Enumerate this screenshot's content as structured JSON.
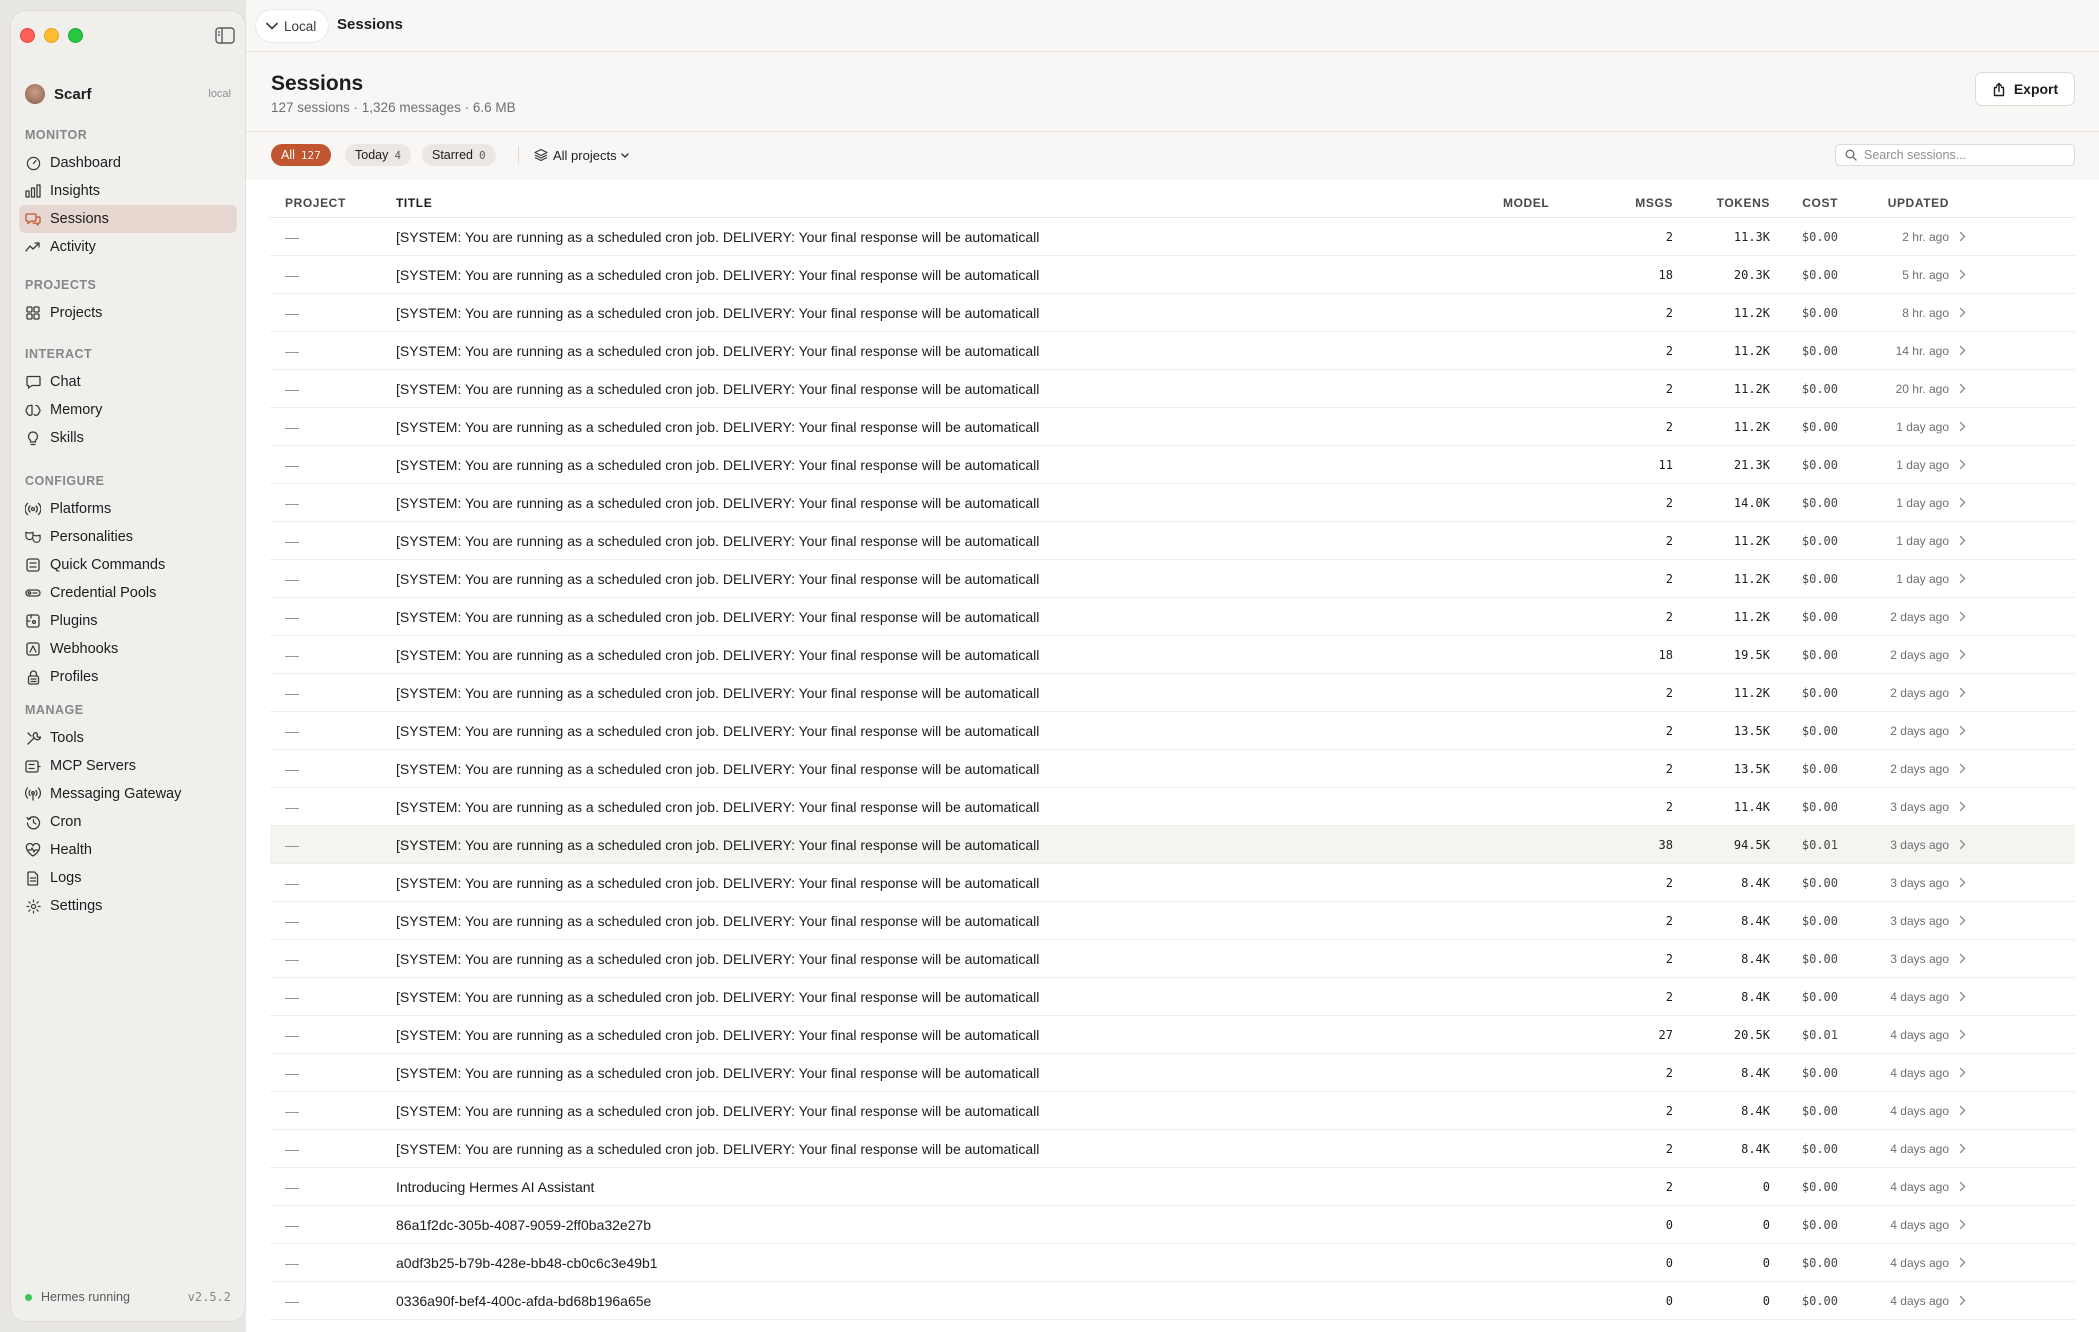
{
  "sidebar": {
    "profile": {
      "name": "Scarf",
      "badge": "local"
    },
    "sections": [
      {
        "heading": "MONITOR",
        "items": [
          {
            "label": "Dashboard",
            "icon": "gauge-icon"
          },
          {
            "label": "Insights",
            "icon": "bar-chart-icon"
          },
          {
            "label": "Sessions",
            "icon": "chat-bubbles-icon",
            "active": true
          },
          {
            "label": "Activity",
            "icon": "activity-icon"
          }
        ]
      },
      {
        "heading": "PROJECTS",
        "items": [
          {
            "label": "Projects",
            "icon": "grid-icon"
          }
        ]
      },
      {
        "heading": "INTERACT",
        "items": [
          {
            "label": "Chat",
            "icon": "chat-icon"
          },
          {
            "label": "Memory",
            "icon": "brain-icon"
          },
          {
            "label": "Skills",
            "icon": "lightbulb-icon"
          }
        ]
      },
      {
        "heading": "CONFIGURE",
        "items": [
          {
            "label": "Platforms",
            "icon": "broadcast-icon"
          },
          {
            "label": "Personalities",
            "icon": "masks-icon"
          },
          {
            "label": "Quick Commands",
            "icon": "command-icon"
          },
          {
            "label": "Credential Pools",
            "icon": "key-icon"
          },
          {
            "label": "Plugins",
            "icon": "puzzle-icon"
          },
          {
            "label": "Webhooks",
            "icon": "webhook-icon"
          },
          {
            "label": "Profiles",
            "icon": "lock-icon"
          }
        ]
      },
      {
        "heading": "MANAGE",
        "items": [
          {
            "label": "Tools",
            "icon": "wrench-icon"
          },
          {
            "label": "MCP Servers",
            "icon": "server-icon"
          },
          {
            "label": "Messaging Gateway",
            "icon": "antenna-icon"
          },
          {
            "label": "Cron",
            "icon": "clock-icon"
          },
          {
            "label": "Health",
            "icon": "heartbeat-icon"
          },
          {
            "label": "Logs",
            "icon": "document-icon"
          },
          {
            "label": "Settings",
            "icon": "gear-icon"
          }
        ]
      }
    ],
    "status": {
      "text": "Hermes running",
      "version": "v2.5.2"
    }
  },
  "topbar": {
    "location": "Local",
    "title": "Sessions"
  },
  "page": {
    "title": "Sessions",
    "subtitle": "127 sessions · 1,326 messages · 6.6 MB",
    "export_label": "Export"
  },
  "filters": {
    "all_label": "All",
    "all_count": "127",
    "today_label": "Today",
    "today_count": "4",
    "starred_label": "Starred",
    "starred_count": "0",
    "projects_label": "All projects",
    "search_placeholder": "Search sessions..."
  },
  "colors": {
    "accent": "#c0552f",
    "status_green": "#34c759"
  },
  "table": {
    "columns": [
      "PROJECT",
      "TITLE",
      "MODEL",
      "MSGS",
      "TOKENS",
      "COST",
      "UPDATED"
    ],
    "rows": [
      {
        "project": "—",
        "title": "[SYSTEM: You are running as a scheduled cron job. DELIVERY: Your final response will be automaticall",
        "model": "",
        "msgs": "2",
        "tokens": "11.3K",
        "cost": "$0.00",
        "updated": "2 hr. ago"
      },
      {
        "project": "—",
        "title": "[SYSTEM: You are running as a scheduled cron job. DELIVERY: Your final response will be automaticall",
        "model": "",
        "msgs": "18",
        "tokens": "20.3K",
        "cost": "$0.00",
        "updated": "5 hr. ago"
      },
      {
        "project": "—",
        "title": "[SYSTEM: You are running as a scheduled cron job. DELIVERY: Your final response will be automaticall",
        "model": "",
        "msgs": "2",
        "tokens": "11.2K",
        "cost": "$0.00",
        "updated": "8 hr. ago"
      },
      {
        "project": "—",
        "title": "[SYSTEM: You are running as a scheduled cron job. DELIVERY: Your final response will be automaticall",
        "model": "",
        "msgs": "2",
        "tokens": "11.2K",
        "cost": "$0.00",
        "updated": "14 hr. ago"
      },
      {
        "project": "—",
        "title": "[SYSTEM: You are running as a scheduled cron job. DELIVERY: Your final response will be automaticall",
        "model": "",
        "msgs": "2",
        "tokens": "11.2K",
        "cost": "$0.00",
        "updated": "20 hr. ago"
      },
      {
        "project": "—",
        "title": "[SYSTEM: You are running as a scheduled cron job. DELIVERY: Your final response will be automaticall",
        "model": "",
        "msgs": "2",
        "tokens": "11.2K",
        "cost": "$0.00",
        "updated": "1 day ago"
      },
      {
        "project": "—",
        "title": "[SYSTEM: You are running as a scheduled cron job. DELIVERY: Your final response will be automaticall",
        "model": "",
        "msgs": "11",
        "tokens": "21.3K",
        "cost": "$0.00",
        "updated": "1 day ago"
      },
      {
        "project": "—",
        "title": "[SYSTEM: You are running as a scheduled cron job. DELIVERY: Your final response will be automaticall",
        "model": "",
        "msgs": "2",
        "tokens": "14.0K",
        "cost": "$0.00",
        "updated": "1 day ago"
      },
      {
        "project": "—",
        "title": "[SYSTEM: You are running as a scheduled cron job. DELIVERY: Your final response will be automaticall",
        "model": "",
        "msgs": "2",
        "tokens": "11.2K",
        "cost": "$0.00",
        "updated": "1 day ago"
      },
      {
        "project": "—",
        "title": "[SYSTEM: You are running as a scheduled cron job. DELIVERY: Your final response will be automaticall",
        "model": "",
        "msgs": "2",
        "tokens": "11.2K",
        "cost": "$0.00",
        "updated": "1 day ago"
      },
      {
        "project": "—",
        "title": "[SYSTEM: You are running as a scheduled cron job. DELIVERY: Your final response will be automaticall",
        "model": "",
        "msgs": "2",
        "tokens": "11.2K",
        "cost": "$0.00",
        "updated": "2 days ago"
      },
      {
        "project": "—",
        "title": "[SYSTEM: You are running as a scheduled cron job. DELIVERY: Your final response will be automaticall",
        "model": "",
        "msgs": "18",
        "tokens": "19.5K",
        "cost": "$0.00",
        "updated": "2 days ago"
      },
      {
        "project": "—",
        "title": "[SYSTEM: You are running as a scheduled cron job. DELIVERY: Your final response will be automaticall",
        "model": "",
        "msgs": "2",
        "tokens": "11.2K",
        "cost": "$0.00",
        "updated": "2 days ago"
      },
      {
        "project": "—",
        "title": "[SYSTEM: You are running as a scheduled cron job. DELIVERY: Your final response will be automaticall",
        "model": "",
        "msgs": "2",
        "tokens": "13.5K",
        "cost": "$0.00",
        "updated": "2 days ago"
      },
      {
        "project": "—",
        "title": "[SYSTEM: You are running as a scheduled cron job. DELIVERY: Your final response will be automaticall",
        "model": "",
        "msgs": "2",
        "tokens": "13.5K",
        "cost": "$0.00",
        "updated": "2 days ago"
      },
      {
        "project": "—",
        "title": "[SYSTEM: You are running as a scheduled cron job. DELIVERY: Your final response will be automaticall",
        "model": "",
        "msgs": "2",
        "tokens": "11.4K",
        "cost": "$0.00",
        "updated": "3 days ago"
      },
      {
        "project": "—",
        "title": "[SYSTEM: You are running as a scheduled cron job. DELIVERY: Your final response will be automaticall",
        "model": "",
        "msgs": "38",
        "tokens": "94.5K",
        "cost": "$0.01",
        "updated": "3 days ago",
        "highlight": true
      },
      {
        "project": "—",
        "title": "[SYSTEM: You are running as a scheduled cron job. DELIVERY: Your final response will be automaticall",
        "model": "",
        "msgs": "2",
        "tokens": "8.4K",
        "cost": "$0.00",
        "updated": "3 days ago"
      },
      {
        "project": "—",
        "title": "[SYSTEM: You are running as a scheduled cron job. DELIVERY: Your final response will be automaticall",
        "model": "",
        "msgs": "2",
        "tokens": "8.4K",
        "cost": "$0.00",
        "updated": "3 days ago"
      },
      {
        "project": "—",
        "title": "[SYSTEM: You are running as a scheduled cron job. DELIVERY: Your final response will be automaticall",
        "model": "",
        "msgs": "2",
        "tokens": "8.4K",
        "cost": "$0.00",
        "updated": "3 days ago"
      },
      {
        "project": "—",
        "title": "[SYSTEM: You are running as a scheduled cron job. DELIVERY: Your final response will be automaticall",
        "model": "",
        "msgs": "2",
        "tokens": "8.4K",
        "cost": "$0.00",
        "updated": "4 days ago"
      },
      {
        "project": "—",
        "title": "[SYSTEM: You are running as a scheduled cron job. DELIVERY: Your final response will be automaticall",
        "model": "",
        "msgs": "27",
        "tokens": "20.5K",
        "cost": "$0.01",
        "updated": "4 days ago"
      },
      {
        "project": "—",
        "title": "[SYSTEM: You are running as a scheduled cron job. DELIVERY: Your final response will be automaticall",
        "model": "",
        "msgs": "2",
        "tokens": "8.4K",
        "cost": "$0.00",
        "updated": "4 days ago"
      },
      {
        "project": "—",
        "title": "[SYSTEM: You are running as a scheduled cron job. DELIVERY: Your final response will be automaticall",
        "model": "",
        "msgs": "2",
        "tokens": "8.4K",
        "cost": "$0.00",
        "updated": "4 days ago"
      },
      {
        "project": "—",
        "title": "[SYSTEM: You are running as a scheduled cron job. DELIVERY: Your final response will be automaticall",
        "model": "",
        "msgs": "2",
        "tokens": "8.4K",
        "cost": "$0.00",
        "updated": "4 days ago"
      },
      {
        "project": "—",
        "title": "Introducing Hermes AI Assistant",
        "model": "",
        "msgs": "2",
        "tokens": "0",
        "cost": "$0.00",
        "updated": "4 days ago"
      },
      {
        "project": "—",
        "title": "86a1f2dc-305b-4087-9059-2ff0ba32e27b",
        "model": "",
        "msgs": "0",
        "tokens": "0",
        "cost": "$0.00",
        "updated": "4 days ago"
      },
      {
        "project": "—",
        "title": "a0df3b25-b79b-428e-bb48-cb0c6c3e49b1",
        "model": "",
        "msgs": "0",
        "tokens": "0",
        "cost": "$0.00",
        "updated": "4 days ago"
      },
      {
        "project": "—",
        "title": "0336a90f-bef4-400c-afda-bd68b196a65e",
        "model": "",
        "msgs": "0",
        "tokens": "0",
        "cost": "$0.00",
        "updated": "4 days ago"
      }
    ]
  }
}
